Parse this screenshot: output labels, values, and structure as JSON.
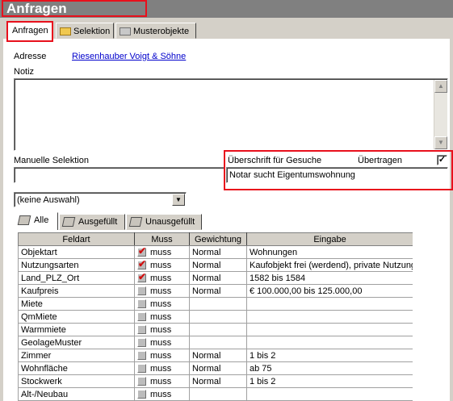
{
  "window": {
    "title": "Anfragen"
  },
  "main_tabs": [
    {
      "label": "Anfragen",
      "active": true
    },
    {
      "label": "Selektion",
      "icon": "folder-open-icon"
    },
    {
      "label": "Musterobjekte",
      "icon": "folder-icon"
    }
  ],
  "address": {
    "label": "Adresse",
    "value": "Riesenhauber Voigt & Söhne"
  },
  "notiz": {
    "label": "Notiz",
    "value": ""
  },
  "manual_selection": {
    "label": "Manuelle Selektion",
    "value": ""
  },
  "heading": {
    "label": "Überschrift für Gesuche",
    "transfer_label": "Übertragen",
    "transfer_checked": true,
    "value": "Notar sucht Eigentumswohnung"
  },
  "selection_dropdown": {
    "value": "(keine Auswahl)"
  },
  "sub_tabs": [
    {
      "label": "Alle",
      "active": true
    },
    {
      "label": "Ausgefüllt"
    },
    {
      "label": "Unausgefüllt"
    }
  ],
  "table": {
    "columns": [
      "Feldart",
      "Muss",
      "Gewichtung",
      "Eingabe"
    ],
    "rows": [
      {
        "feldart": "Objektart",
        "muss": true,
        "muss_label": "muss",
        "gewichtung": "Normal",
        "eingabe": "Wohnungen"
      },
      {
        "feldart": "Nutzungsarten",
        "muss": true,
        "muss_label": "muss",
        "gewichtung": "Normal",
        "eingabe": "Kaufobjekt frei (werdend), private Nutzung"
      },
      {
        "feldart": "Land_PLZ_Ort",
        "muss": true,
        "muss_label": "muss",
        "gewichtung": "Normal",
        "eingabe": "1582 bis 1584"
      },
      {
        "feldart": "Kaufpreis",
        "muss": false,
        "muss_label": "muss",
        "gewichtung": "Normal",
        "eingabe": "€ 100.000,00 bis 125.000,00"
      },
      {
        "feldart": "Miete",
        "muss": false,
        "muss_label": "muss",
        "gewichtung": "",
        "eingabe": ""
      },
      {
        "feldart": "QmMiete",
        "muss": false,
        "muss_label": "muss",
        "gewichtung": "",
        "eingabe": ""
      },
      {
        "feldart": "Warmmiete",
        "muss": false,
        "muss_label": "muss",
        "gewichtung": "",
        "eingabe": ""
      },
      {
        "feldart": "GeolageMuster",
        "muss": false,
        "muss_label": "muss",
        "gewichtung": "",
        "eingabe": ""
      },
      {
        "feldart": "Zimmer",
        "muss": false,
        "muss_label": "muss",
        "gewichtung": "Normal",
        "eingabe": "1 bis 2"
      },
      {
        "feldart": "Wohnfläche",
        "muss": false,
        "muss_label": "muss",
        "gewichtung": "Normal",
        "eingabe": "ab 75"
      },
      {
        "feldart": "Stockwerk",
        "muss": false,
        "muss_label": "muss",
        "gewichtung": "Normal",
        "eingabe": "1 bis 2"
      },
      {
        "feldart": "Alt-/Neubau",
        "muss": false,
        "muss_label": "muss",
        "gewichtung": "",
        "eingabe": ""
      }
    ]
  },
  "colors": {
    "highlight": "#e8101c",
    "link": "#0000cc",
    "check": "#d01010",
    "window_bg": "#d4d0c8",
    "titlebar": "#808080"
  }
}
